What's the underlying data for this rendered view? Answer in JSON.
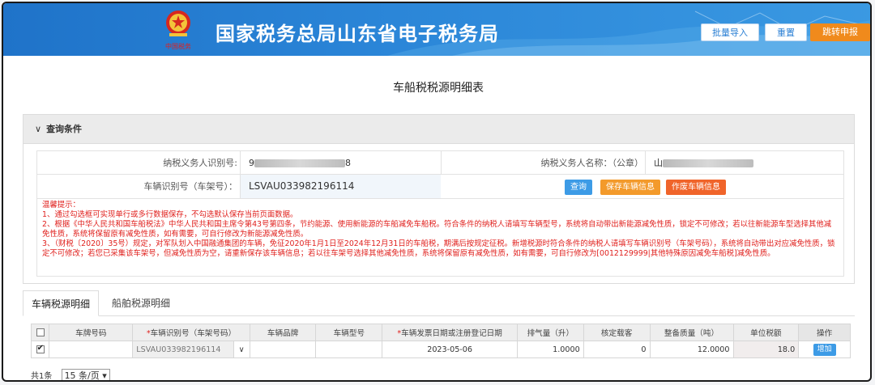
{
  "header": {
    "site_title": "国家税务总局山东省电子税务局",
    "emblem_caption": "中国税务",
    "buttons": {
      "import": "批量导入",
      "reset": "重置",
      "jump": "跳转申报"
    },
    "colors": {
      "header_blue": "#2b86d8",
      "jump_orange": "#f08a1c"
    }
  },
  "form": {
    "title": "车船税税源明细表"
  },
  "query": {
    "section_label": "查询条件",
    "taxpayer_id_label": "纳税义务人识别号:",
    "taxpayer_id_value_prefix": "9",
    "taxpayer_id_value_suffix": "8",
    "taxpayer_name_label": "纳税义务人名称：（公章）",
    "taxpayer_name_value_prefix": "山",
    "vin_label": "车辆识别号（车架号）：",
    "vin_value": "LSVAU033982196114",
    "buttons": {
      "query": "查询",
      "save": "保存车辆信息",
      "void": "作废车辆信息"
    },
    "button_colors": {
      "query": "#3d9be6",
      "save": "#f39a2b",
      "void": "#f0642a"
    }
  },
  "tips": {
    "heading": "温馨提示：",
    "line1": "1、通过勾选框可实现单行或多行数据保存，不勾选默认保存当前页面数据。",
    "line2": "2、根据《中华人民共和国车船税法》中华人民共和国主席令第43号第四条，节约能源、使用新能源的车船减免车船税。符合条件的纳税人请填写车辆型号，系统将自动带出新能源减免性质，锁定不可修改；若以往新能源车型选择其他减免性质，系统将保留原有减免性质，如有需要，可自行修改为新能源减免性质。",
    "line3": "3、（财税〔2020〕35号）规定，对军队划入中国融通集团的车辆，免征2020年1月1日至2024年12月31日的车船税，期满后按规定征税。新增税源时符合条件的纳税人请填写车辆识别号（车架号码），系统将自动带出对应减免性质，锁定不可修改；若您已采集该车架号，但减免性质为空，请重新保存该车辆信息；若以往车架号选择其他减免性质，系统将保留原有减免性质，如有需要，可自行修改为[0012129999|其他特殊原因减免车船税]减免性质。"
  },
  "tabs": {
    "vehicle": "车辆税源明细",
    "vessel": "船舶税源明细"
  },
  "table": {
    "headers": {
      "plate": "车牌号码",
      "vin": "车辆识别号（车架号码）",
      "brand": "车辆品牌",
      "model": "车辆型号",
      "date": "车辆发票日期或注册登记日期",
      "displacement": "排气量（升）",
      "seats": "核定载客",
      "mass": "整备质量（吨）",
      "unit_tax": "单位税额",
      "ops": "操作"
    },
    "row": {
      "vin": "LSVAU033982196114",
      "date": "2023-05-06",
      "displacement": "1.0000",
      "seats": "0",
      "mass": "12.0000",
      "unit_tax": "18.0",
      "add": "增加"
    }
  },
  "pager": {
    "total": "共1条",
    "page_size": "15 条/页"
  }
}
